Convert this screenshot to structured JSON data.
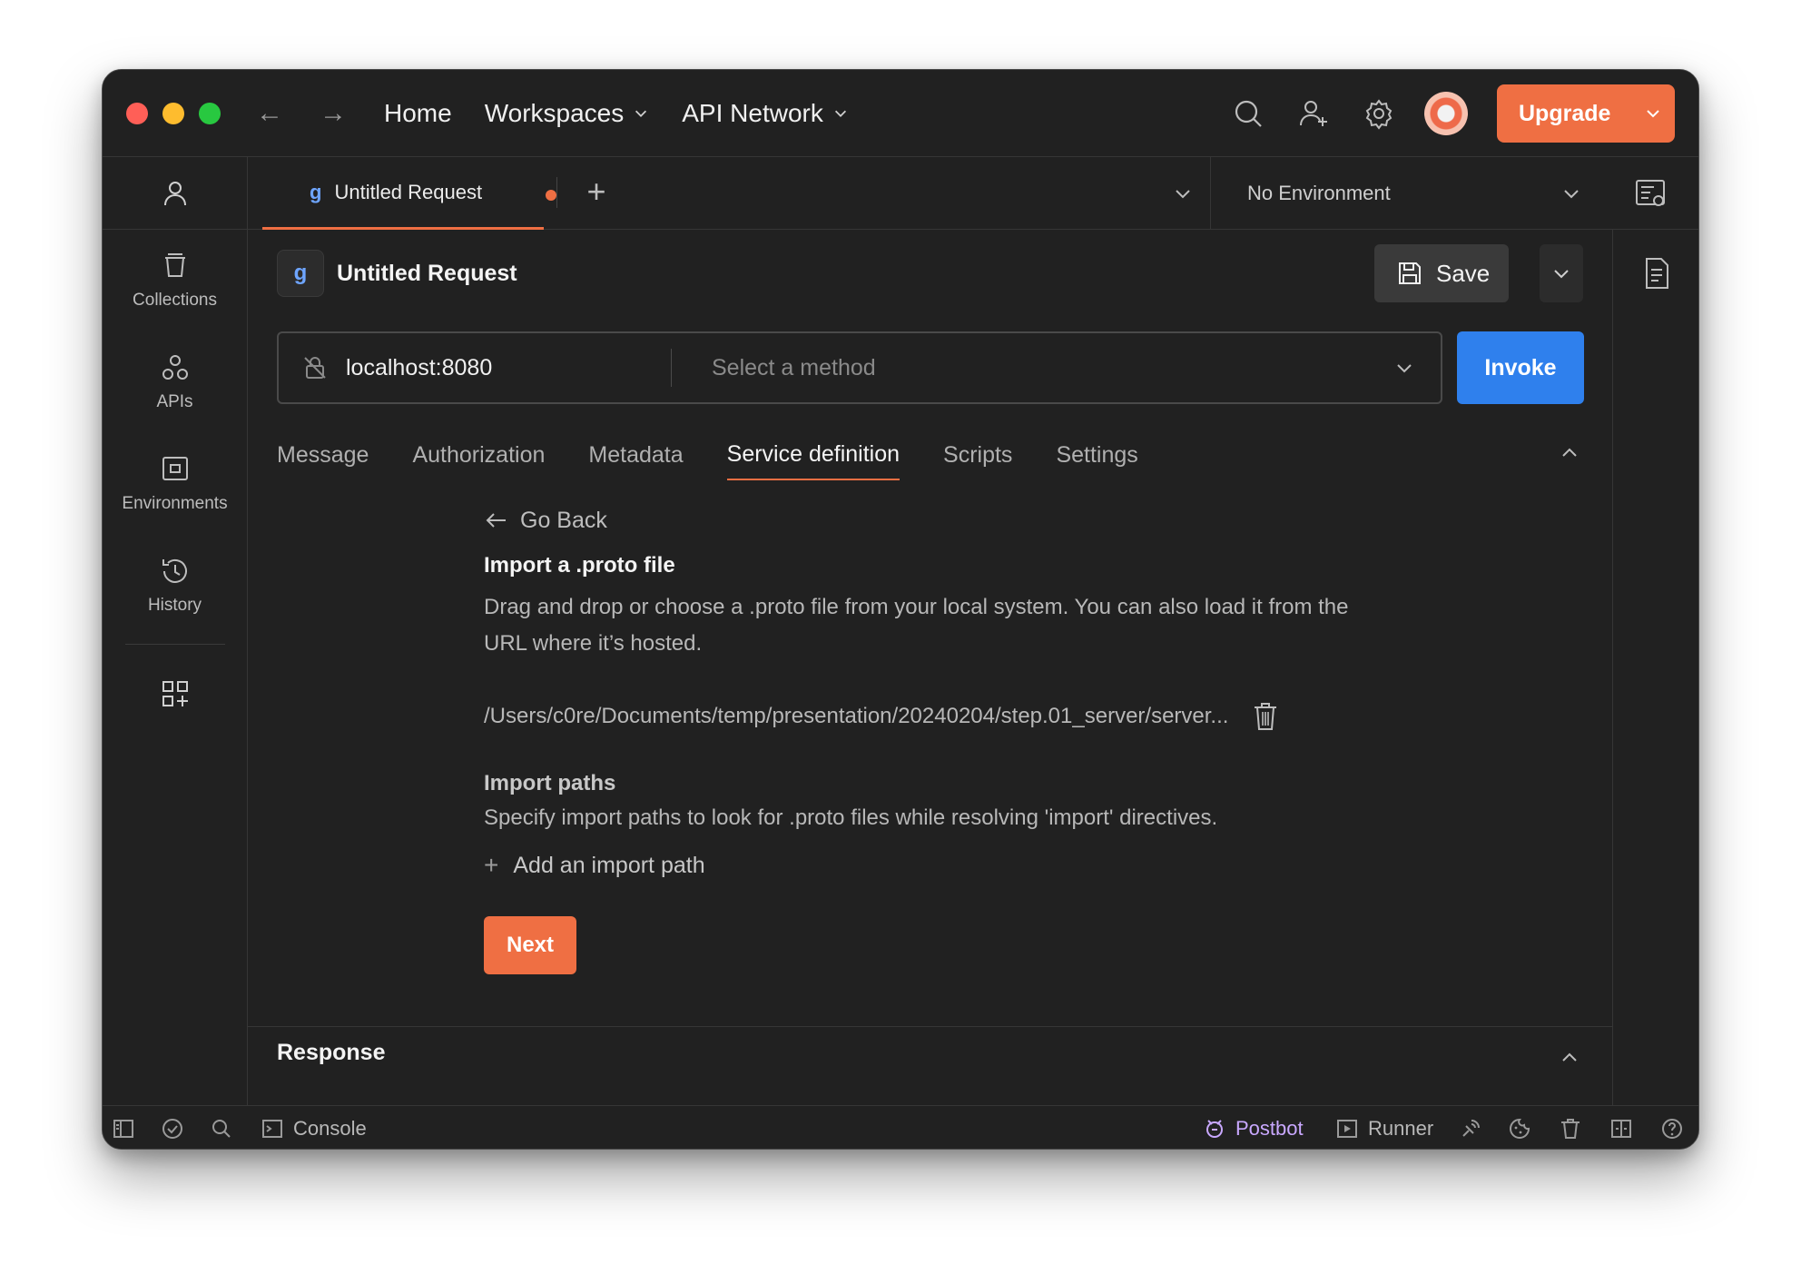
{
  "titlebar": {
    "nav": {
      "home": "Home",
      "workspaces": "Workspaces",
      "api_network": "API Network"
    },
    "upgrade_label": "Upgrade",
    "icons": [
      "search-icon",
      "invite-user-icon",
      "settings-gear-icon",
      "notification-bell-icon"
    ]
  },
  "sidebar": {
    "items": [
      {
        "label": "Collections",
        "icon": "collections-icon"
      },
      {
        "label": "APIs",
        "icon": "apis-icon"
      },
      {
        "label": "Environments",
        "icon": "environments-icon"
      },
      {
        "label": "History",
        "icon": "history-icon"
      }
    ]
  },
  "tabs": {
    "active": {
      "type_badge": "g",
      "title": "Untitled Request",
      "unsaved": true
    }
  },
  "environment": {
    "selected": "No Environment"
  },
  "request": {
    "title": "Untitled Request",
    "type_badge": "g",
    "save_label": "Save",
    "url": "localhost:8080",
    "method_placeholder": "Select a method",
    "invoke_label": "Invoke",
    "subtabs": [
      "Message",
      "Authorization",
      "Metadata",
      "Service definition",
      "Scripts",
      "Settings"
    ],
    "active_subtab": "Service definition"
  },
  "service_definition": {
    "go_back": "Go Back",
    "import_title": "Import a .proto file",
    "import_desc": "Drag and drop or choose a .proto file from your local system. You can also load it from the URL where it’s hosted.",
    "file_path": "/Users/c0re/Documents/temp/presentation/20240204/step.01_server/server...",
    "paths_title": "Import paths",
    "paths_desc": "Specify import paths to look for .proto files while resolving 'import' directives.",
    "add_path": "Add an import path",
    "next_label": "Next"
  },
  "response": {
    "label": "Response"
  },
  "statusbar": {
    "console": "Console",
    "postbot": "Postbot",
    "runner": "Runner"
  },
  "colors": {
    "accent": "#ef6f43",
    "invoke": "#2f80ed",
    "grpc": "#6ea5ff",
    "background": "#212121"
  }
}
